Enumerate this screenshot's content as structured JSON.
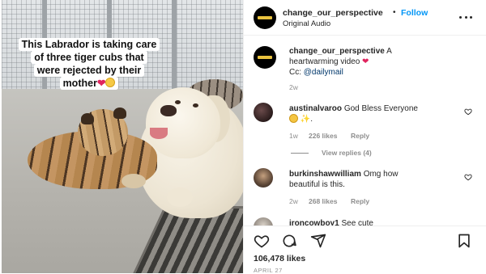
{
  "post": {
    "caption_lines": [
      "This Labrador is taking care",
      "of three tiger cubs that",
      "were rejected by their",
      "mother"
    ],
    "caption_emojis": [
      "red-heart",
      "crying-face"
    ]
  },
  "header": {
    "username": "change_our_perspective",
    "separator": "•",
    "follow_label": "Follow",
    "audio_label": "Original Audio"
  },
  "caption_comment": {
    "username": "change_our_perspective",
    "text": "A heartwarming video",
    "emoji": "red-heart",
    "credit_prefix": "Cc:",
    "mention": "@dailymail",
    "time": "2w"
  },
  "comments": [
    {
      "username": "austinalvaroo",
      "text": "God Bless Everyone",
      "emojis": [
        "smiling-face-with-halo",
        "sparkles"
      ],
      "trailing": ".",
      "time": "1w",
      "likes": "226 likes",
      "reply_label": "Reply",
      "view_replies": "View replies (4)"
    },
    {
      "username": "burkinshawwilliam",
      "text_line1": "Omg how",
      "text_line2": "beautiful is this.",
      "time": "2w",
      "likes": "268 likes",
      "reply_label": "Reply"
    },
    {
      "username": "ironcowboy1",
      "text": "See cute"
    }
  ],
  "actions": {
    "icons": [
      "heart-icon",
      "comment-icon",
      "share-icon",
      "bookmark-icon"
    ],
    "likes": "106,478 likes",
    "date": "APRIL 27"
  },
  "colors": {
    "follow": "#0095f6",
    "mention": "#00376b",
    "muted": "#8e8e8e",
    "text": "#262626",
    "heart": "#e0245e"
  }
}
